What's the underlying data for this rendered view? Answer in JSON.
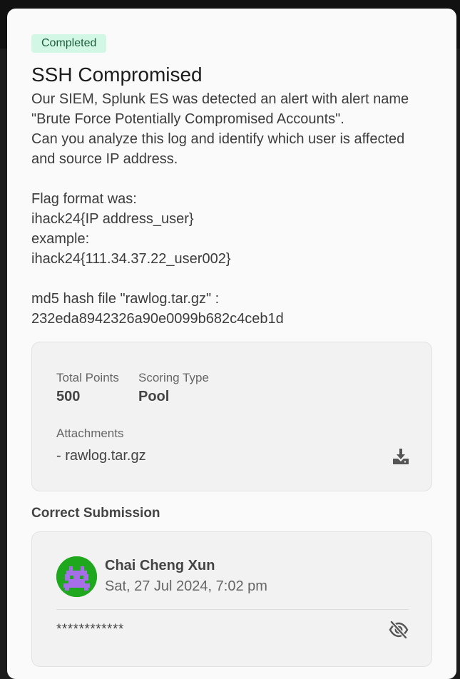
{
  "challenge": {
    "status_badge": "Completed",
    "title": "SSH Compromised",
    "description_lines": [
      "Our SIEM, Splunk ES was detected an alert with alert name",
      "\"Brute Force Potentially Compromised Accounts\".",
      "Can you analyze this log and identify which user is affected",
      "and source IP address.",
      "",
      "Flag format was:",
      "ihack24{IP address_user}",
      "example:",
      "ihack24{111.34.37.22_user002}",
      "",
      "md5 hash file \"rawlog.tar.gz\" :",
      "232eda8942326a90e0099b682c4ceb1d"
    ]
  },
  "info": {
    "points_label": "Total Points",
    "points_value": "500",
    "scoring_label": "Scoring Type",
    "scoring_value": "Pool",
    "attachments_label": "Attachments",
    "attachment_name": "- rawlog.tar.gz",
    "download_icon": "download-icon"
  },
  "submission": {
    "heading": "Correct Submission",
    "user_name": "Chai Cheng Xun",
    "timestamp": "Sat, 27 Jul 2024, 7:02 pm",
    "masked_flag": "************",
    "reveal_icon": "eye-off-icon",
    "avatar_colors": {
      "background": "#1fa81d",
      "figure": "#a66ee8"
    }
  },
  "colors": {
    "badge_bg": "#d2f7e4",
    "badge_text": "#1b5e3d",
    "card_bg": "#f2f2f2",
    "modal_bg": "#fafafa"
  }
}
